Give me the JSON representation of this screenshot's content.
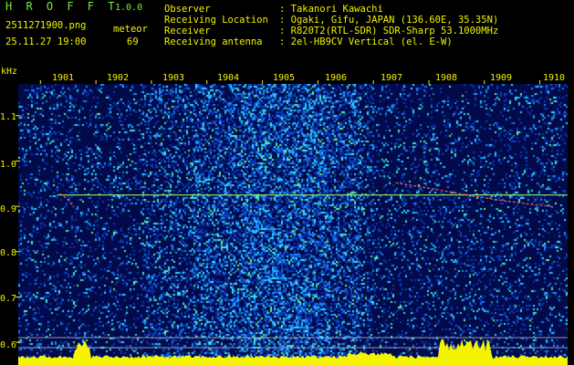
{
  "header": {
    "app_title": "H R O F F T",
    "version": "1.0.0",
    "filename": "2511271900.png",
    "classification": "meteor",
    "datetime": "25.11.27 19:00",
    "count": "69"
  },
  "info": {
    "labels": [
      "Observer",
      "Receiving Location",
      "Receiver",
      "Receiving antenna"
    ],
    "values": [
      ": Takanori Kawachi",
      ": Ogaki, Gifu, JAPAN (136.60E, 35.35N)",
      ": R820T2(RTL-SDR) SDR-Sharp 53.1000MHz",
      ": 2el-HB9CV Vertical (el. E-W)"
    ]
  },
  "chart_data": {
    "type": "heatmap",
    "title": "",
    "xlabel": "",
    "ylabel": "kHz",
    "x_ticks": [
      "1901",
      "1902",
      "1903",
      "1904",
      "1905",
      "1906",
      "1907",
      "1908",
      "1909",
      "1910"
    ],
    "y_ticks": [
      "1.1",
      "1.0",
      "0.9",
      "0.8",
      "0.7",
      "0.6"
    ],
    "y_tick_values": [
      1.1,
      1.0,
      0.9,
      0.8,
      0.7,
      0.6
    ],
    "xlim": [
      1900.6,
      1910.5
    ],
    "ylim": [
      0.55,
      1.17
    ],
    "carrier_khz": 0.925,
    "traces": [
      {
        "x": [
          1901.35,
          1901.5,
          1901.6
        ],
        "y": [
          0.928,
          0.915,
          0.898
        ]
      },
      {
        "x": [
          1907.4,
          1908.0,
          1908.6,
          1909.2,
          1909.8,
          1910.2
        ],
        "y": [
          0.952,
          0.94,
          0.927,
          0.915,
          0.905,
          0.9
        ]
      }
    ],
    "colors": {
      "background": "#000000",
      "noise_low": "#00229a",
      "noise_high": "#19c8ff",
      "carrier": "#8ef06a",
      "trace": "#ff5a5a",
      "baseline": "#f4f400",
      "floor": "#00c8f0"
    }
  }
}
